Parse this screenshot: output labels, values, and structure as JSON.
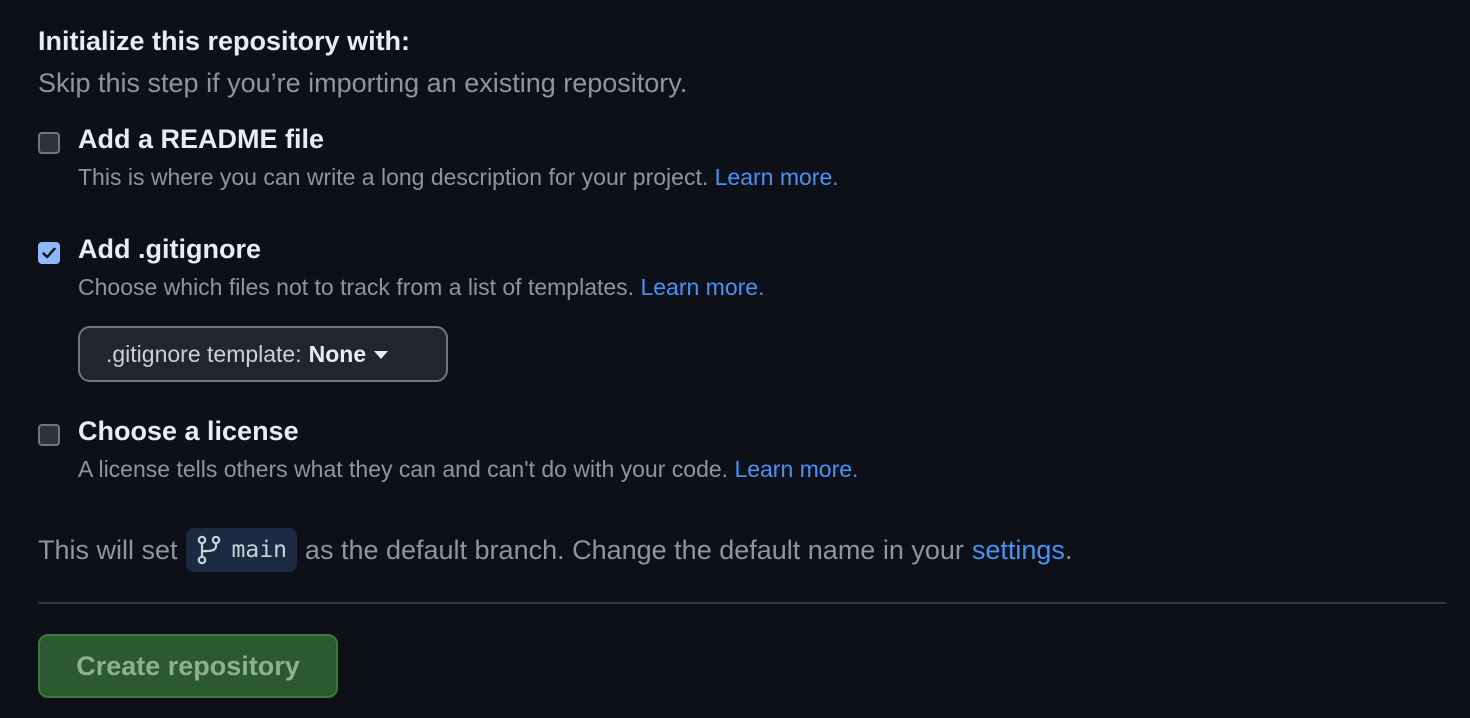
{
  "section": {
    "heading": "Initialize this repository with:",
    "subheading": "Skip this step if you’re importing an existing repository."
  },
  "options": {
    "readme": {
      "title": "Add a README file",
      "desc": "This is where you can write a long description for your project. ",
      "link": "Learn more.",
      "checked": false
    },
    "gitignore": {
      "title": "Add .gitignore",
      "desc": "Choose which files not to track from a list of templates. ",
      "link": "Learn more.",
      "checked": true,
      "dropdown_label": ".gitignore template:",
      "dropdown_value": "None"
    },
    "license": {
      "title": "Choose a license",
      "desc": "A license tells others what they can and can't do with your code. ",
      "link": "Learn more.",
      "checked": false
    }
  },
  "branch": {
    "prefix": "This will set",
    "name": "main",
    "suffix": "as the default branch. Change the default name in your",
    "settings_link": "settings",
    "end": "."
  },
  "actions": {
    "create_label": "Create repository"
  },
  "colors": {
    "background": "#0d1117",
    "link": "#4493f8",
    "checkbox_checked": "#8fb8ff",
    "create_button": "#2b5a30"
  },
  "icons": {
    "checkmark": "check-icon",
    "branch": "git-branch-icon",
    "caret": "caret-down-icon"
  }
}
